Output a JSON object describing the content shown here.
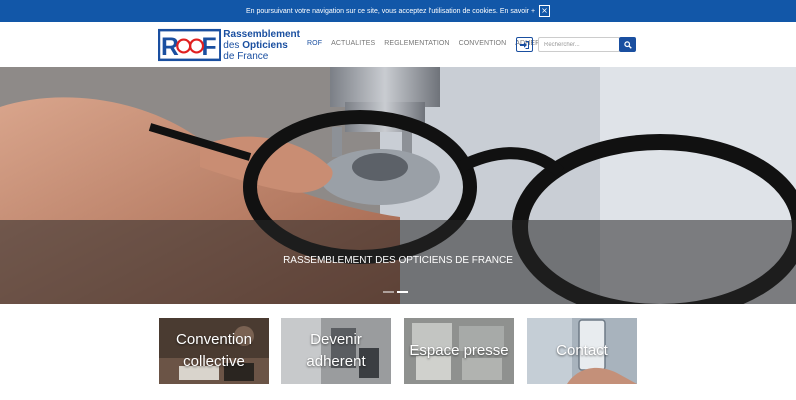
{
  "cookie": {
    "text": "En poursuivant votre navigation sur ce site, vous acceptez l'utilisation de cookies. En savoir +",
    "close_label": "×"
  },
  "logo": {
    "letters": "ROF",
    "line1": "Rassemblement",
    "line2_prefix": "des ",
    "line2_bold": "Opticiens",
    "line3": "de France"
  },
  "nav": {
    "items": [
      {
        "label": "ROF",
        "active": true
      },
      {
        "label": "ACTUALITES",
        "active": false
      },
      {
        "label": "REGLEMENTATION",
        "active": false
      },
      {
        "label": "CONVENTION",
        "active": false
      },
      {
        "label": "ADHERENT",
        "active": false
      }
    ],
    "login_icon": "sign-in-icon"
  },
  "search": {
    "placeholder": "Rechercher...",
    "value": "",
    "button_icon": "search-icon"
  },
  "hero": {
    "caption": "RASSEMBLEMENT DES OPTICIENS DE FRANCE",
    "slides": 2,
    "active_slide": 2
  },
  "tiles": [
    {
      "line1": "Convention",
      "line2": "collective"
    },
    {
      "line1": "Devenir",
      "line2": "adherent"
    },
    {
      "line1": "Espace presse",
      "line2": ""
    },
    {
      "line1": "Contact",
      "line2": ""
    }
  ],
  "colors": {
    "brand": "#1a4fa0",
    "cookie_bar": "#1257a8",
    "logo_red": "#e02020"
  }
}
